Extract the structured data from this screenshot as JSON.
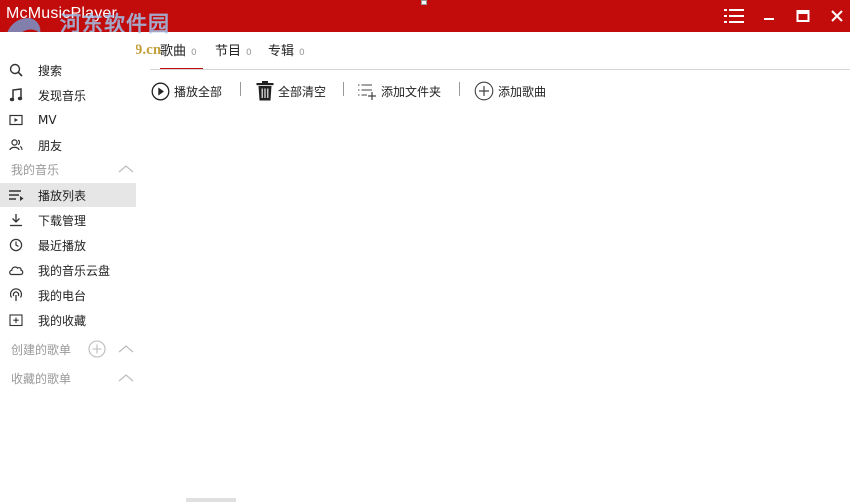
{
  "app": {
    "title": "McMusicPlayer"
  },
  "watermark": {
    "line1": "河东软件园",
    "line2": "www.pc0359.cn"
  },
  "window_controls": [
    "menu-icon",
    "minimize-icon",
    "maximize-icon",
    "close-icon"
  ],
  "sidebar": {
    "items": [
      {
        "label": "搜索",
        "icon": "search-icon"
      },
      {
        "label": "发现音乐",
        "icon": "music-note-icon"
      },
      {
        "label": "MV",
        "icon": "video-icon"
      },
      {
        "label": "朋友",
        "icon": "friends-icon"
      }
    ],
    "my_music": {
      "title": "我的音乐",
      "items": [
        {
          "label": "播放列表",
          "icon": "playlist-icon",
          "active": true
        },
        {
          "label": "下载管理",
          "icon": "download-icon"
        },
        {
          "label": "最近播放",
          "icon": "clock-icon"
        },
        {
          "label": "我的音乐云盘",
          "icon": "cloud-icon"
        },
        {
          "label": "我的电台",
          "icon": "radio-icon"
        },
        {
          "label": "我的收藏",
          "icon": "favorite-folder-icon"
        }
      ]
    },
    "created_playlists": {
      "title": "创建的歌单"
    },
    "collected_playlists": {
      "title": "收藏的歌单"
    }
  },
  "tabs": [
    {
      "label": "歌曲",
      "count": "0",
      "active": true
    },
    {
      "label": "节目",
      "count": "0"
    },
    {
      "label": "专辑",
      "count": "0"
    }
  ],
  "toolbar": {
    "play_all": "播放全部",
    "clear_all": "全部清空",
    "add_folder": "添加文件夹",
    "add_song": "添加歌曲"
  },
  "colors": {
    "accent": "#c20c0c",
    "active_bg": "#e6e6e6",
    "muted": "#999999"
  }
}
